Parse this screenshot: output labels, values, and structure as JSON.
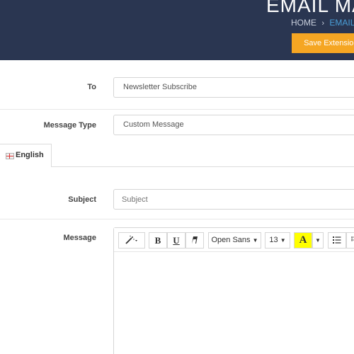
{
  "header": {
    "title": "EMAIL MA",
    "breadcrumb": {
      "home": "HOME",
      "separator": "›",
      "current": "EMAIL M"
    },
    "save_button": "Save Extension S"
  },
  "form": {
    "to": {
      "label": "To",
      "value": "Newsletter Subscribe"
    },
    "message_type": {
      "label": "Message Type",
      "value": "Custom Message"
    },
    "language_tab": {
      "label": "English"
    },
    "subject": {
      "label": "Subject",
      "placeholder": "Subject"
    },
    "message": {
      "label": "Message"
    }
  },
  "editor_toolbar": {
    "style_icon": "magic-wand-icon",
    "bold": "B",
    "underline": "U",
    "eraser_icon": "eraser-icon",
    "font_family": "Open Sans",
    "font_size": "13",
    "color_letter": "A",
    "list_icon": "unordered-list-icon"
  },
  "colors": {
    "header_bg": "#2a3651",
    "accent_button": "#f5a623",
    "link": "#4a9fd8",
    "highlight": "#ffff00"
  }
}
